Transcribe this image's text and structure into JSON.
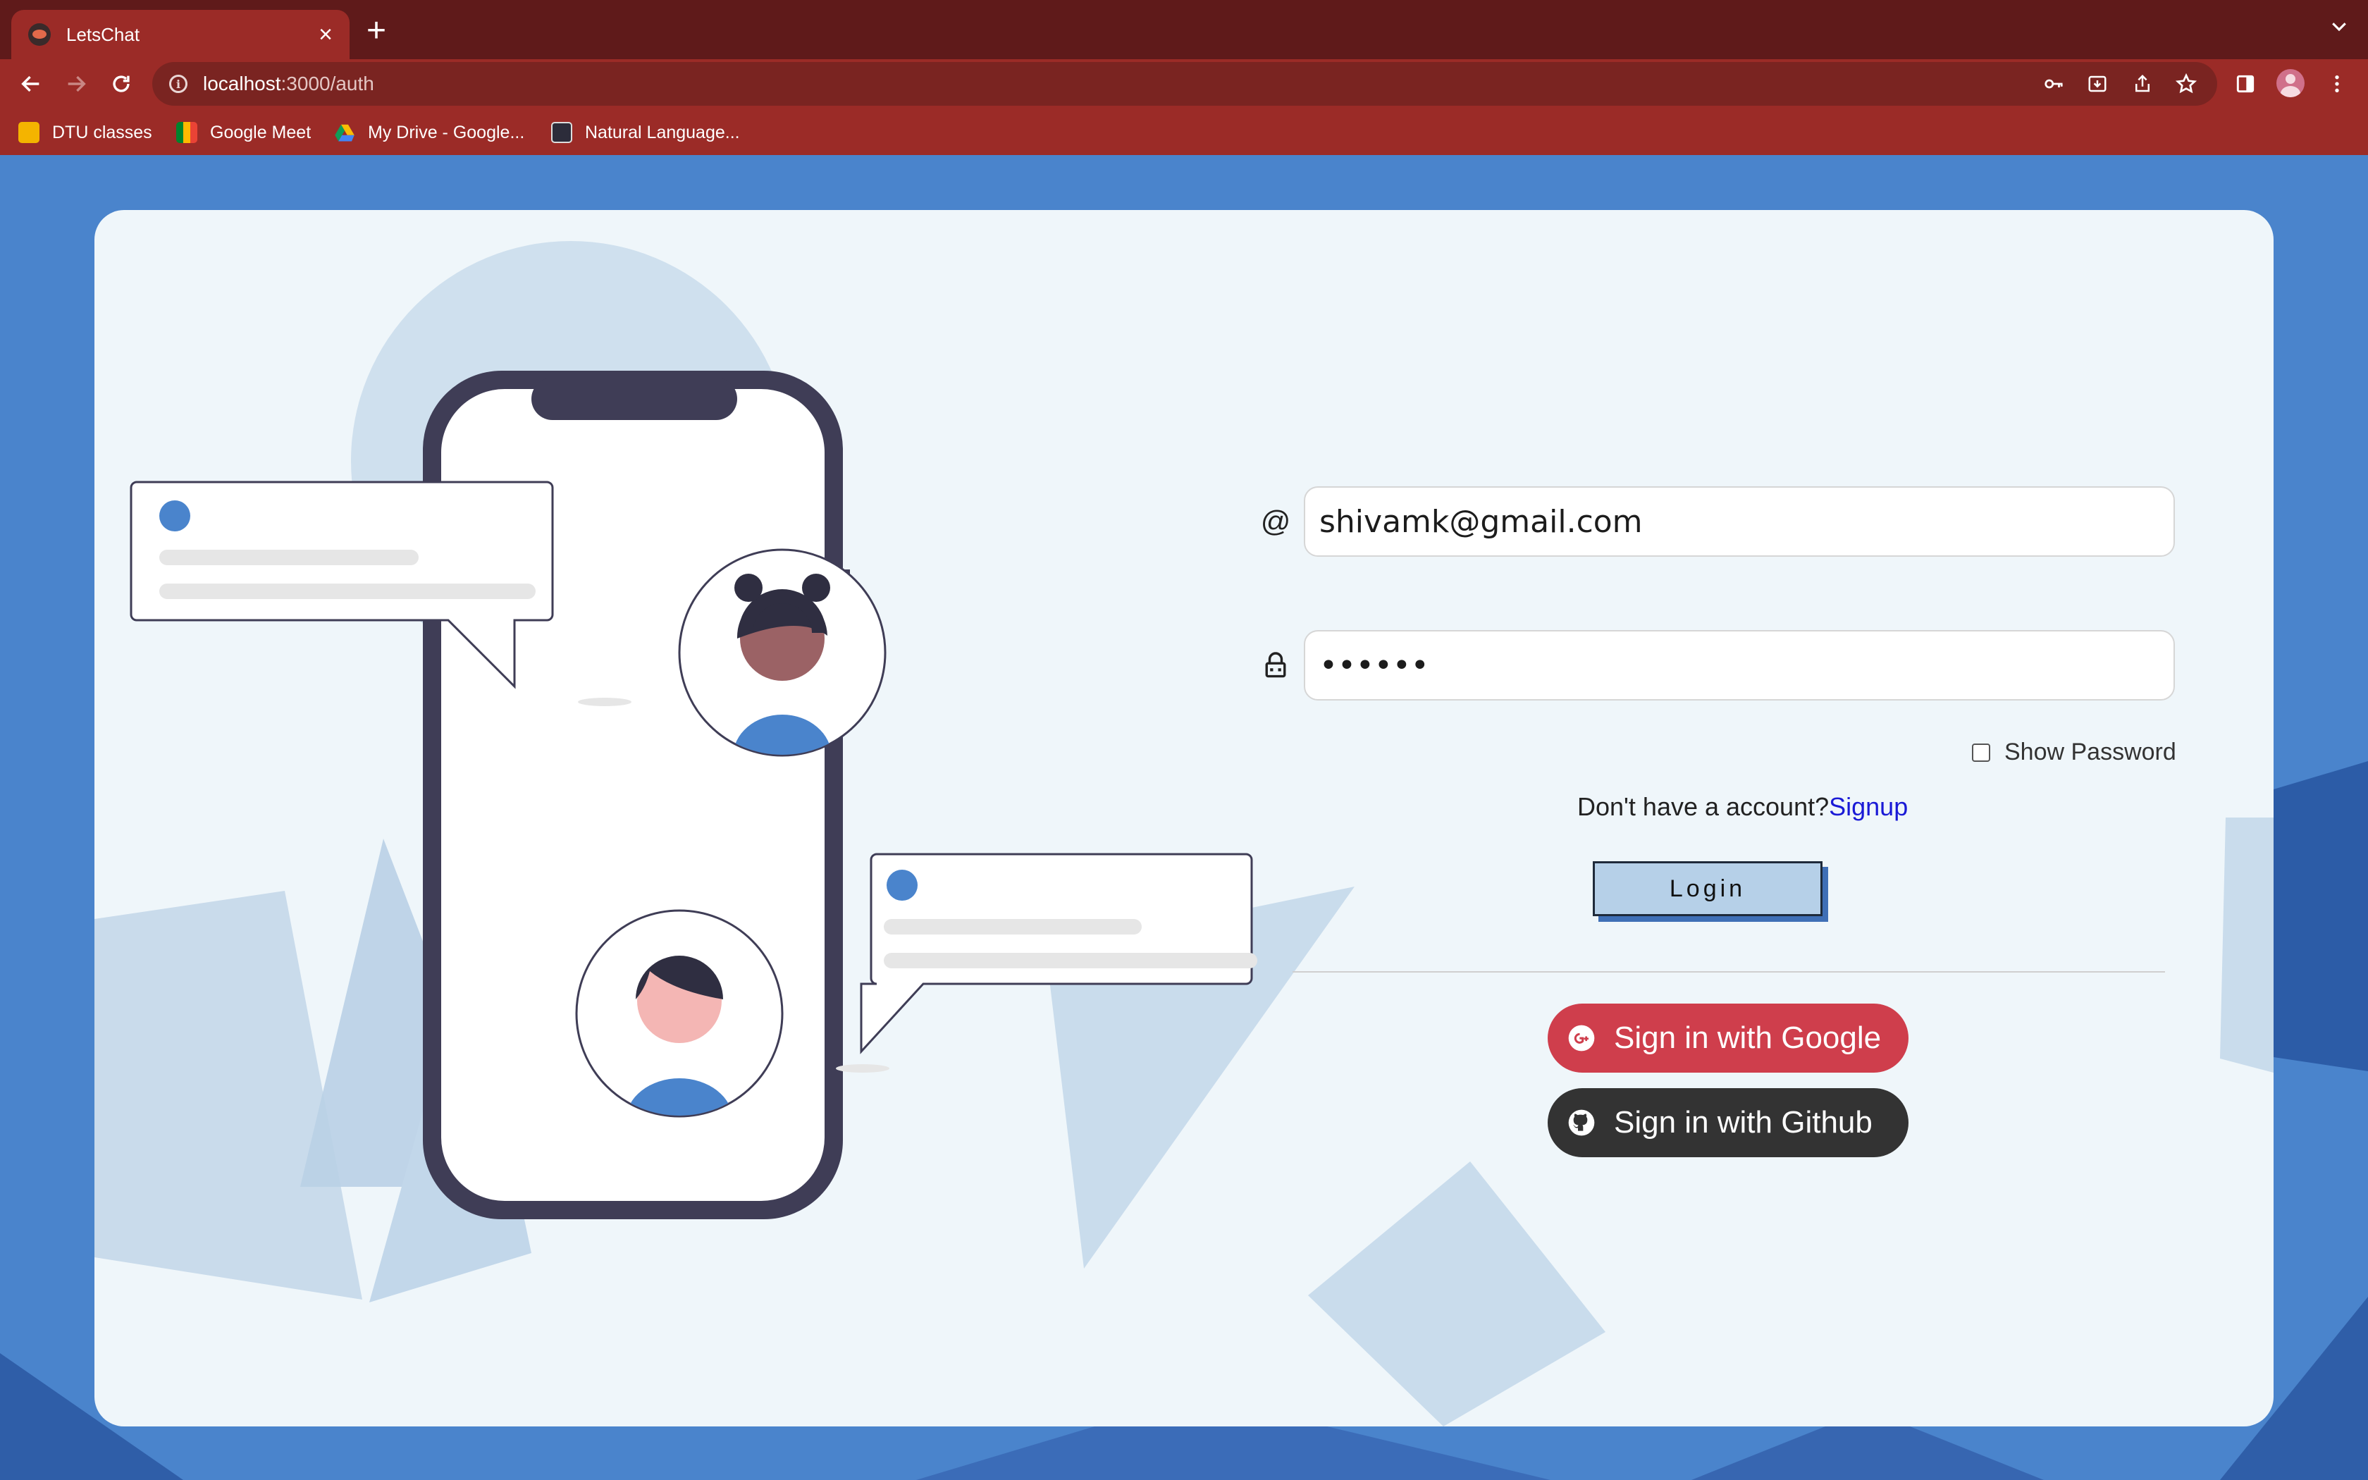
{
  "browser": {
    "tab_title": "LetsChat",
    "new_tab_symbol": "+",
    "url_host": "localhost",
    "url_path": ":3000/auth",
    "bookmarks": [
      {
        "label": "DTU classes",
        "icon": "google-classroom-icon"
      },
      {
        "label": "Google Meet",
        "icon": "google-meet-icon"
      },
      {
        "label": "My Drive - Google...",
        "icon": "google-drive-icon"
      },
      {
        "label": "Natural Language...",
        "icon": "website-icon"
      }
    ]
  },
  "login": {
    "email_symbol": "@",
    "email_value": "shivamk@gmail.com",
    "password_value": "••••••",
    "show_password_label": "Show Password",
    "no_account_text": "Don't have a account?",
    "signup_label": "Signup",
    "login_label": "Login",
    "google_label": "Sign in with Google",
    "github_label": "Sign in with Github"
  },
  "colors": {
    "browser_frame": "#9b2b27",
    "page_background": "#4a84cc",
    "card_background": "#eff6fa",
    "google_button": "#cf3e4c",
    "github_button": "#333333",
    "login_button": "#b6d0e8",
    "signup_link": "#1a1ad6"
  }
}
